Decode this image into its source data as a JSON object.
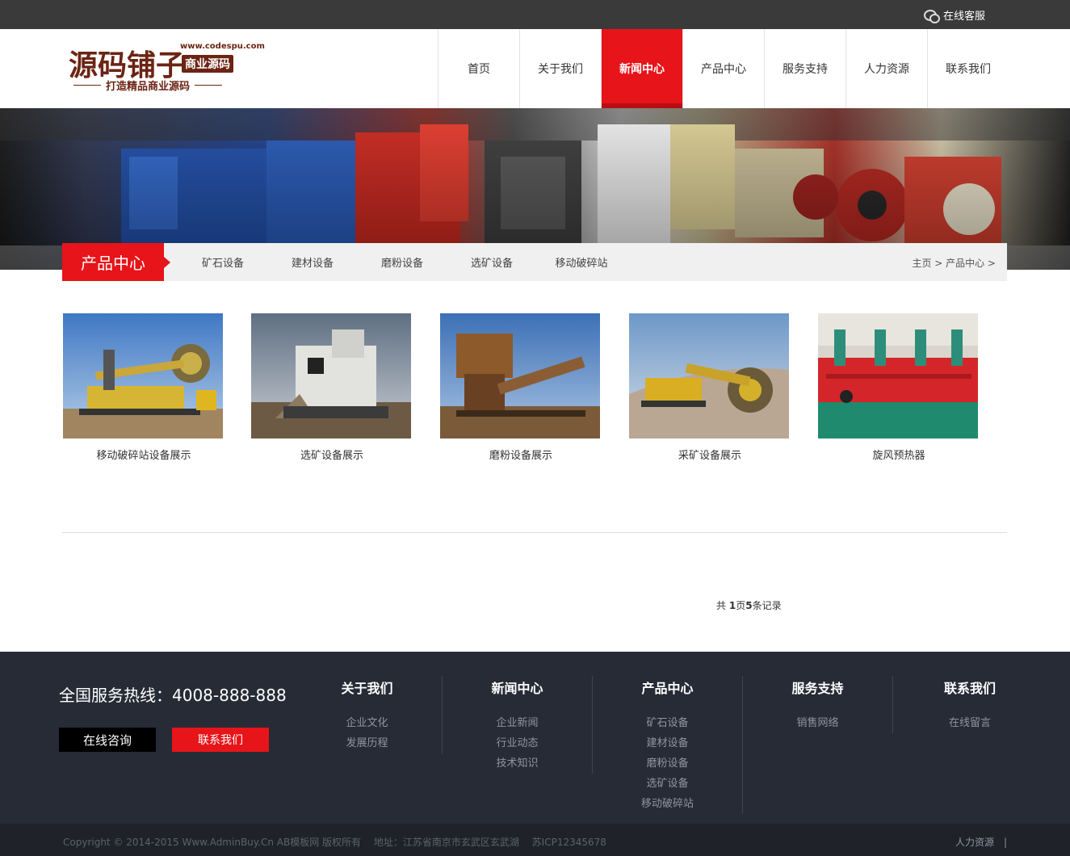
{
  "topbar": {
    "service_label": "在线客服",
    "service_icon": "chat-bubble-icon"
  },
  "logo": {
    "brand": "源码铺子",
    "url": "www.codespu.com",
    "tag": "商业源码",
    "slogan": "打造精品商业源码"
  },
  "nav": {
    "items": [
      "首页",
      "关于我们",
      "新闻中心",
      "产品中心",
      "服务支持",
      "人力资源",
      "联系我们"
    ],
    "active": "新闻中心"
  },
  "subnav": {
    "title": "产品中心",
    "categories": [
      "矿石设备",
      "建材设备",
      "磨粉设备",
      "选矿设备",
      "移动破碎站"
    ],
    "breadcrumb": "主页 > 产品中心 >"
  },
  "products": [
    {
      "caption": "移动破碎站设备展示"
    },
    {
      "caption": "选矿设备展示"
    },
    {
      "caption": "磨粉设备展示"
    },
    {
      "caption": "采矿设备展示"
    },
    {
      "caption": "旋风预热器"
    }
  ],
  "pager": {
    "prefix": "共 ",
    "pages": "1",
    "mid": "页",
    "records": "5",
    "suffix": "条记录"
  },
  "footer": {
    "hotline": "全国服务热线：4008-888-888",
    "consult_label": "在线咨询",
    "contact_label": "联系我们",
    "columns": [
      {
        "title": "关于我们",
        "links": [
          "企业文化",
          "发展历程"
        ]
      },
      {
        "title": "新闻中心",
        "links": [
          "企业新闻",
          "行业动态",
          "技术知识"
        ]
      },
      {
        "title": "产品中心",
        "links": [
          "矿石设备",
          "建材设备",
          "磨粉设备",
          "选矿设备",
          "移动破碎站"
        ]
      },
      {
        "title": "服务支持",
        "links": [
          "销售网络"
        ]
      },
      {
        "title": "联系我们",
        "links": [
          "在线留言"
        ]
      }
    ],
    "copyright": "Copyright © 2014-2015 Www.AdminBuy.Cn AB模板网 版权所有　 地址：江苏省南京市玄武区玄武湖　 苏ICP12345678",
    "right_link": "人力资源　|"
  },
  "colors": {
    "accent": "#e7141a",
    "topbar": "#3a3a3a",
    "footer": "#272b36",
    "brand": "#6b2414"
  }
}
